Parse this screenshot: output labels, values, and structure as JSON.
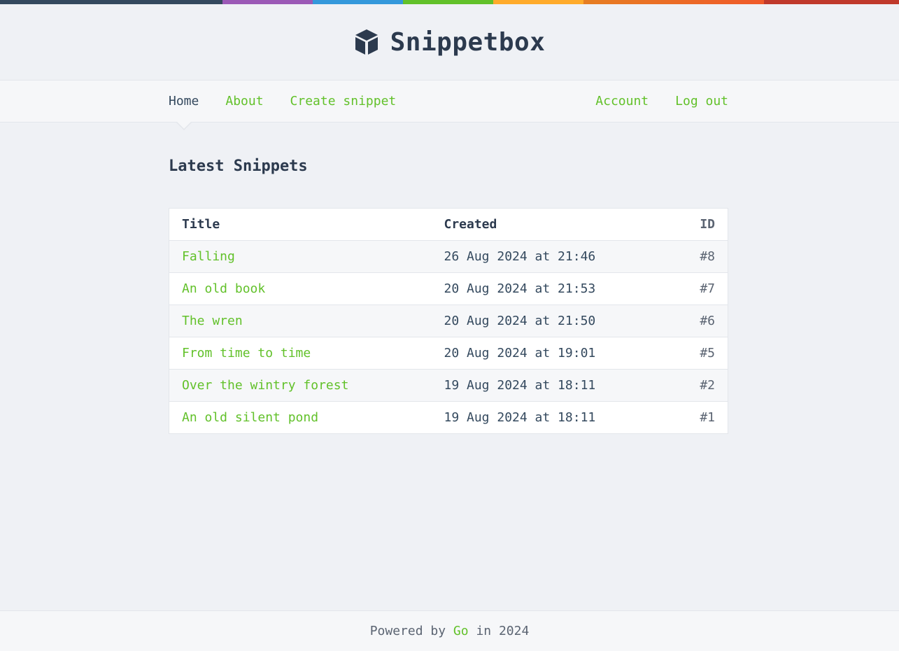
{
  "brand": {
    "name": "Snippetbox",
    "icon": "cube-icon"
  },
  "nav": {
    "left": [
      {
        "label": "Home",
        "active": true
      },
      {
        "label": "About"
      },
      {
        "label": "Create snippet"
      }
    ],
    "right": [
      {
        "label": "Account"
      },
      {
        "label": "Log out"
      }
    ]
  },
  "page": {
    "heading": "Latest Snippets"
  },
  "table": {
    "headers": {
      "title": "Title",
      "created": "Created",
      "id": "ID"
    },
    "rows": [
      {
        "title": "Falling",
        "created": "26 Aug 2024 at 21:46",
        "id": "#8"
      },
      {
        "title": "An old book",
        "created": "20 Aug 2024 at 21:53",
        "id": "#7"
      },
      {
        "title": "The wren",
        "created": "20 Aug 2024 at 21:50",
        "id": "#6"
      },
      {
        "title": "From time to time",
        "created": "20 Aug 2024 at 19:01",
        "id": "#5"
      },
      {
        "title": "Over the wintry forest",
        "created": "19 Aug 2024 at 18:11",
        "id": "#2"
      },
      {
        "title": "An old silent pond",
        "created": "19 Aug 2024 at 18:11",
        "id": "#1"
      }
    ]
  },
  "footer": {
    "prefix": "Powered by",
    "link": "Go",
    "suffix": "in 2024"
  },
  "colors": {
    "accent": "#62c12a",
    "text": "#34495e",
    "background": "#eff1f5",
    "bar": [
      "#34495e",
      "#9b59b6",
      "#3498db",
      "#62c12a",
      "#ffab2b",
      "#e67e22",
      "#c0392b"
    ]
  }
}
